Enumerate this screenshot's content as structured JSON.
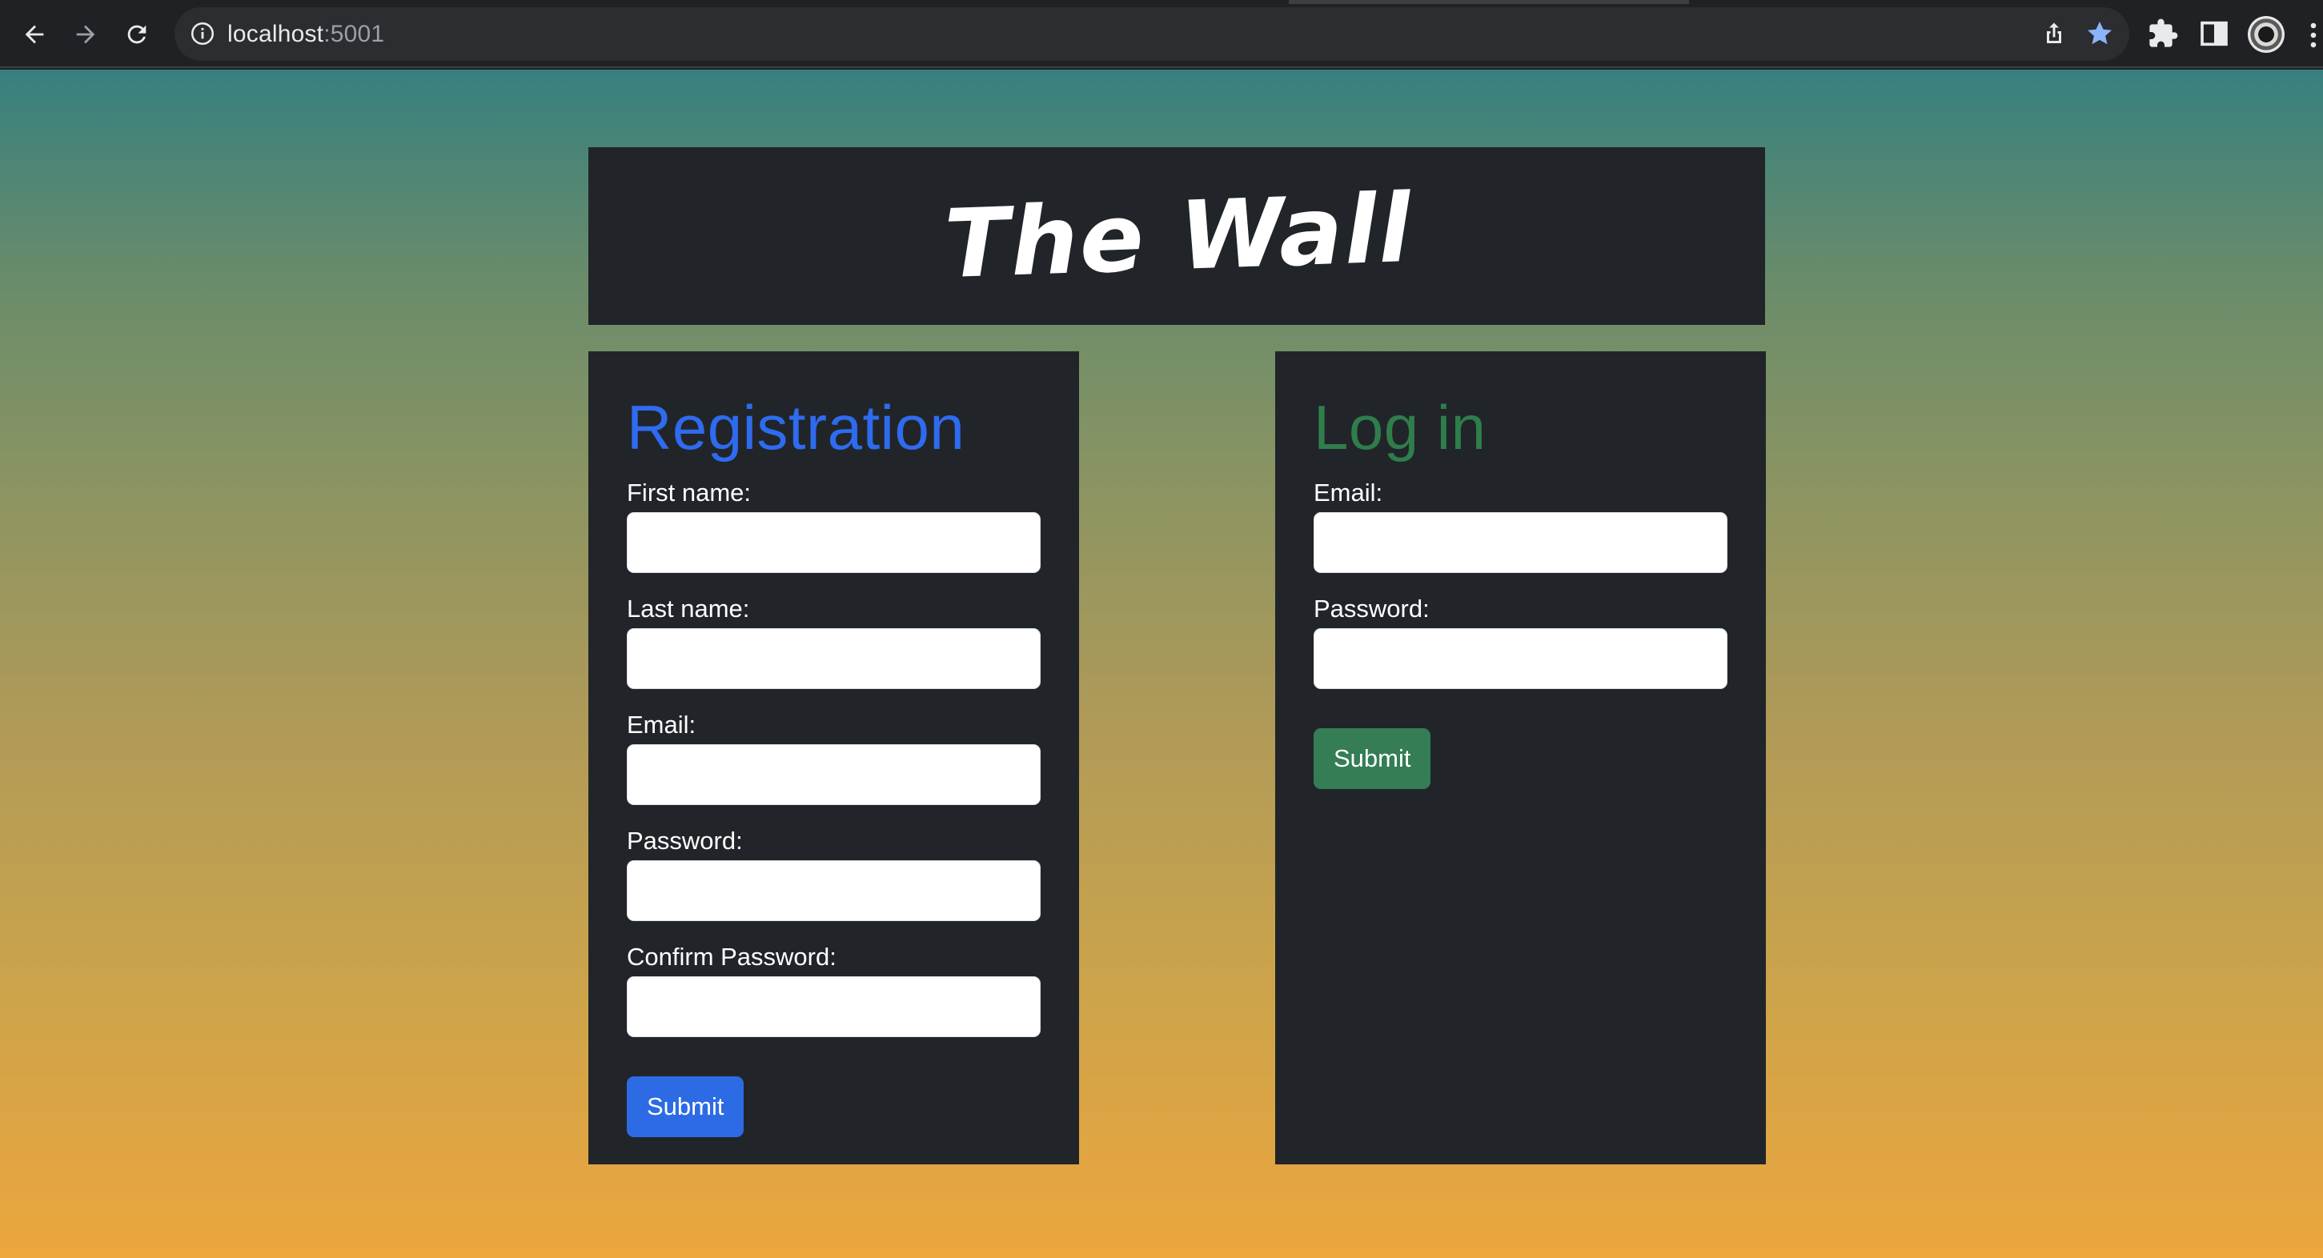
{
  "browser": {
    "url_host": "localhost",
    "url_port": ":5001",
    "star_color": "#8ab4f8",
    "icons": [
      "back-arrow-icon",
      "forward-arrow-icon",
      "reload-icon",
      "info-icon",
      "share-icon",
      "star-icon",
      "extensions-icon",
      "side-panel-icon",
      "profile-avatar",
      "menu-dots-icon"
    ]
  },
  "header": {
    "title": "The Wall"
  },
  "registration": {
    "title": "Registration",
    "title_color": "#2e6bef",
    "fields": [
      {
        "label": "First name:",
        "value": ""
      },
      {
        "label": "Last name:",
        "value": ""
      },
      {
        "label": "Email:",
        "value": ""
      },
      {
        "label": "Password:",
        "value": ""
      },
      {
        "label": "Confirm Password:",
        "value": ""
      }
    ],
    "submit_label": "Submit",
    "button_color": "#2d6be4"
  },
  "login": {
    "title": "Log in",
    "title_color": "#2f7d4c",
    "fields": [
      {
        "label": "Email:",
        "value": ""
      },
      {
        "label": "Password:",
        "value": ""
      }
    ],
    "submit_label": "Submit",
    "button_color": "#347d55"
  }
}
